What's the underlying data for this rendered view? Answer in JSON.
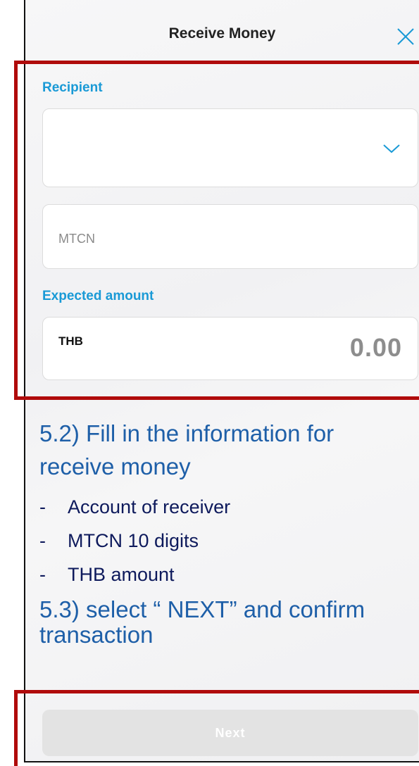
{
  "header": {
    "title": "Receive Money",
    "close_icon": "close-icon"
  },
  "form": {
    "recipient_label": "Recipient",
    "recipient_value": "",
    "mtcn_placeholder": "MTCN",
    "expected_amount_label": "Expected amount",
    "currency": "THB",
    "amount_value": "0.00"
  },
  "instructions": {
    "step_5_2_line1": "5.2) Fill in the information for",
    "step_5_2_line2": "receive money",
    "bullets": [
      "Account of receiver",
      "MTCN 10 digits",
      "THB amount"
    ],
    "bullet_marker": "-",
    "step_5_3_line1": "5.3) select “ NEXT” and confirm",
    "step_5_3_line2": "transaction"
  },
  "footer": {
    "next_label": "Next"
  },
  "colors": {
    "accent": "#1a9ad6",
    "highlight_border": "#b00b0b",
    "instruction_text": "#1e5fa8",
    "disabled_button": "#e3e3e3"
  }
}
